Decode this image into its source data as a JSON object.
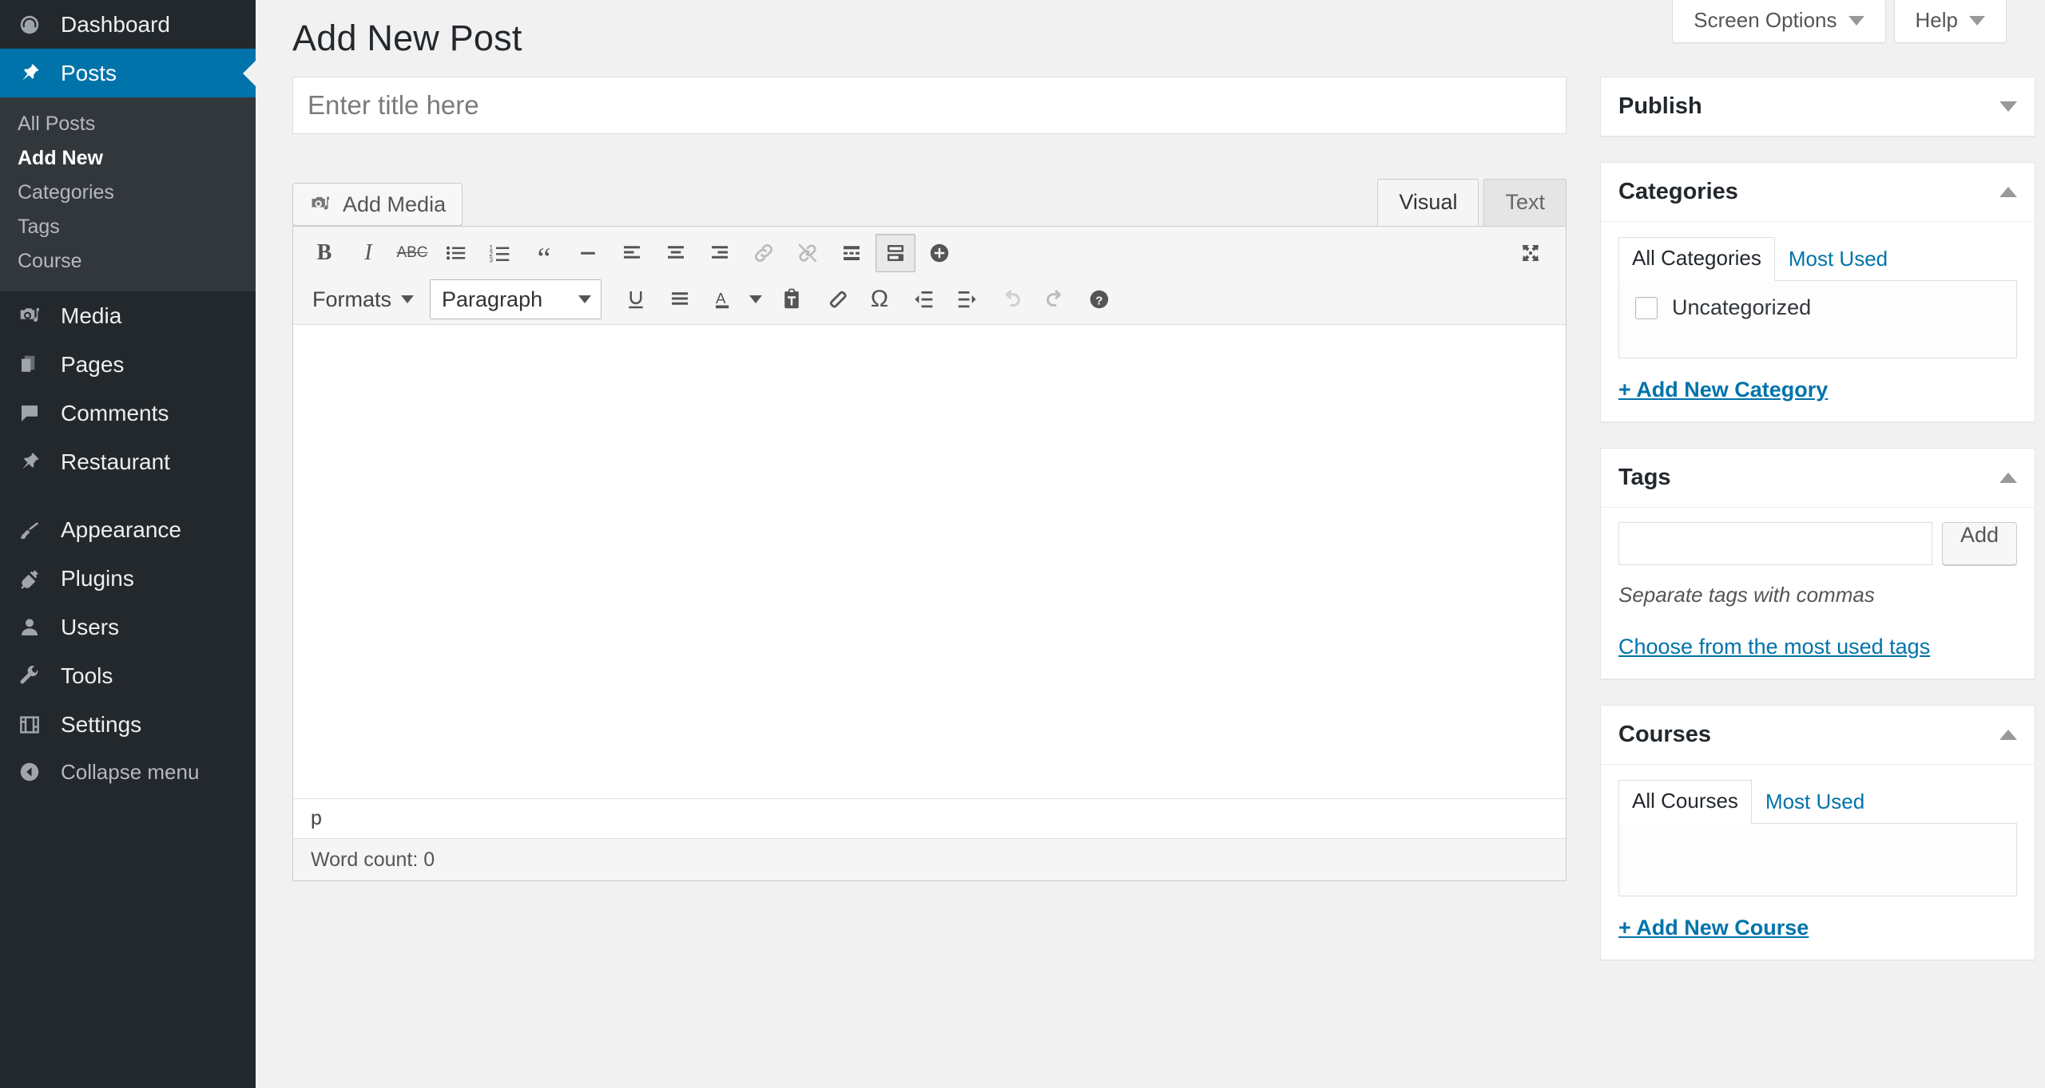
{
  "sidebar": {
    "items": [
      {
        "label": "Dashboard",
        "icon": "dashboard-icon",
        "active": false
      },
      {
        "label": "Posts",
        "icon": "pin-icon",
        "active": true
      },
      {
        "label": "Media",
        "icon": "media-icon",
        "active": false
      },
      {
        "label": "Pages",
        "icon": "pages-icon",
        "active": false
      },
      {
        "label": "Comments",
        "icon": "comments-icon",
        "active": false
      },
      {
        "label": "Restaurant",
        "icon": "pin-icon",
        "active": false
      },
      {
        "label": "Appearance",
        "icon": "brush-icon",
        "active": false
      },
      {
        "label": "Plugins",
        "icon": "plug-icon",
        "active": false
      },
      {
        "label": "Users",
        "icon": "user-icon",
        "active": false
      },
      {
        "label": "Tools",
        "icon": "wrench-icon",
        "active": false
      },
      {
        "label": "Settings",
        "icon": "settings-icon",
        "active": false
      }
    ],
    "submenu": [
      {
        "label": "All Posts",
        "current": false
      },
      {
        "label": "Add New",
        "current": true
      },
      {
        "label": "Categories",
        "current": false
      },
      {
        "label": "Tags",
        "current": false
      },
      {
        "label": "Course",
        "current": false
      }
    ],
    "collapse_label": "Collapse menu",
    "active_color": "#0073aa",
    "background": "#23282d",
    "submenu_background": "#32373c"
  },
  "screen_meta": {
    "screen_options": "Screen Options",
    "help": "Help"
  },
  "page": {
    "title": "Add New Post"
  },
  "post_title": {
    "placeholder": "Enter title here",
    "value": ""
  },
  "editor": {
    "add_media": "Add Media",
    "tabs": [
      {
        "label": "Visual",
        "active": true
      },
      {
        "label": "Text",
        "active": false
      }
    ],
    "toolbar_row1": [
      {
        "name": "bold-icon",
        "glyph": "B"
      },
      {
        "name": "italic-icon",
        "glyph": "I"
      },
      {
        "name": "strikethrough-icon",
        "glyph": "ABC"
      },
      {
        "name": "bullet-list-icon",
        "glyph": ""
      },
      {
        "name": "numbered-list-icon",
        "glyph": ""
      },
      {
        "name": "blockquote-icon",
        "glyph": "“"
      },
      {
        "name": "horizontal-rule-icon",
        "glyph": ""
      },
      {
        "name": "align-left-icon",
        "glyph": ""
      },
      {
        "name": "align-center-icon",
        "glyph": ""
      },
      {
        "name": "align-right-icon",
        "glyph": ""
      },
      {
        "name": "link-icon",
        "glyph": ""
      },
      {
        "name": "unlink-icon",
        "glyph": ""
      },
      {
        "name": "read-more-icon",
        "glyph": ""
      },
      {
        "name": "toolbar-toggle-icon",
        "glyph": ""
      },
      {
        "name": "add-block-icon",
        "glyph": ""
      }
    ],
    "formats_label": "Formats",
    "paragraph_label": "Paragraph",
    "toolbar_row2": [
      {
        "name": "underline-icon"
      },
      {
        "name": "justify-icon"
      },
      {
        "name": "text-color-icon"
      },
      {
        "name": "paste-as-text-icon"
      },
      {
        "name": "clear-formatting-icon"
      },
      {
        "name": "special-character-icon"
      },
      {
        "name": "outdent-icon"
      },
      {
        "name": "indent-icon"
      },
      {
        "name": "undo-icon"
      },
      {
        "name": "redo-icon"
      },
      {
        "name": "keyboard-help-icon"
      }
    ],
    "fullscreen_icon": "distraction-free-icon",
    "body_value": "",
    "path": "p",
    "word_count": "Word count: 0"
  },
  "publish_box": {
    "title": "Publish",
    "collapsed": true
  },
  "categories_box": {
    "title": "Categories",
    "collapsed": false,
    "tabs": [
      {
        "label": "All Categories",
        "active": true
      },
      {
        "label": "Most Used",
        "active": false
      }
    ],
    "items": [
      {
        "label": "Uncategorized",
        "checked": false
      }
    ],
    "add_link": "+ Add New Category"
  },
  "tags_box": {
    "title": "Tags",
    "collapsed": false,
    "input_value": "",
    "add_button": "Add",
    "hint": "Separate tags with commas",
    "choose_link": "Choose from the most used tags"
  },
  "courses_box": {
    "title": "Courses",
    "collapsed": false,
    "tabs": [
      {
        "label": "All Courses",
        "active": true
      },
      {
        "label": "Most Used",
        "active": false
      }
    ],
    "items": [],
    "add_link": "+ Add New Course"
  },
  "colors": {
    "accent": "#0073aa",
    "link": "#0073aa",
    "sidebar_dark": "#23282d",
    "page_bg": "#f1f1f1"
  }
}
